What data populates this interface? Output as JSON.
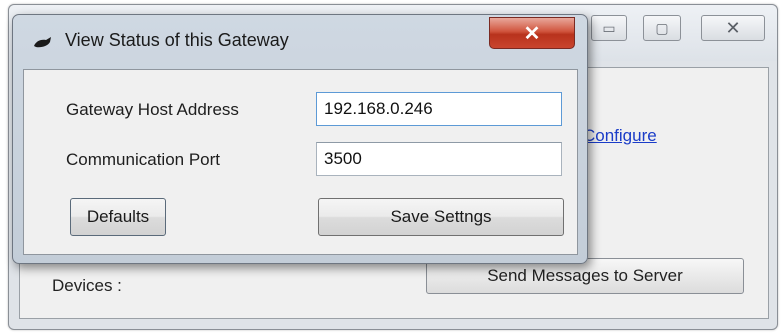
{
  "background_window": {
    "controls": {
      "minimize_glyph": "▭",
      "maximize_glyph": "▢",
      "close_glyph": "✕"
    },
    "configure_link": "Configure",
    "devices_label": "Devices :",
    "send_button_label": "Send Messages to Server"
  },
  "dialog": {
    "title": "View Status of this Gateway",
    "close_glyph": "✕",
    "host_label": "Gateway Host Address",
    "host_value": "192.168.0.246",
    "port_label": "Communication Port",
    "port_value": "3500",
    "defaults_button_label": "Defaults",
    "save_button_label": "Save Settngs",
    "colors": {
      "close_button": "#c9452e",
      "focus_border": "#5d9ad6",
      "link": "#1a3cc8"
    }
  }
}
